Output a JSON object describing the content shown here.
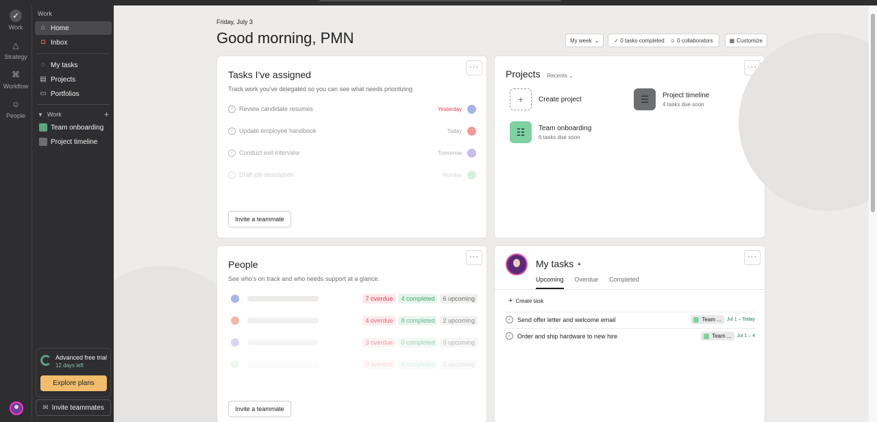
{
  "rail": {
    "items": [
      {
        "label": "Work",
        "icon": "check-circle-icon"
      },
      {
        "label": "Strategy",
        "icon": "triangle-icon"
      },
      {
        "label": "Workflow",
        "icon": "workflow-icon"
      },
      {
        "label": "People",
        "icon": "people-icon"
      }
    ]
  },
  "sidebar": {
    "header": "Work",
    "nav": [
      {
        "label": "Home",
        "icon": "home-icon"
      },
      {
        "label": "Inbox",
        "icon": "bell-icon"
      }
    ],
    "items": [
      {
        "label": "My tasks",
        "icon": "check-circle-icon"
      },
      {
        "label": "Projects",
        "icon": "clipboard-icon"
      },
      {
        "label": "Portfolios",
        "icon": "folder-icon"
      }
    ],
    "section_label": "Work",
    "projects": [
      {
        "label": "Team onboarding",
        "color": "#5da283"
      },
      {
        "label": "Project timeline",
        "color": "#6d6e6f"
      }
    ],
    "trial": {
      "title": "Advanced free trial",
      "days": "12 days left",
      "cta": "Explore plans"
    },
    "invite": "Invite teammates"
  },
  "header": {
    "date": "Friday, July 3",
    "greeting": "Good morning, PMN",
    "week": "My week",
    "tasks_completed": "0 tasks completed",
    "collaborators": "0 collaborators",
    "customize": "Customize"
  },
  "assigned": {
    "title": "Tasks I've assigned",
    "subtitle": "Track work you've delegated so you can see what needs prioritizing",
    "tasks": [
      {
        "name": "Review candidate resumes",
        "due": "Yesterday",
        "due_color": "#e8384f",
        "avatar_color": "#a6b4e8",
        "opacity": 1
      },
      {
        "name": "Update employee handbook",
        "due": "Today",
        "due_color": "#9a9a9a",
        "avatar_color": "#f08f8f",
        "opacity": 0.9
      },
      {
        "name": "Conduct exit interview",
        "due": "Tomorrow",
        "due_color": "#9a9a9a",
        "avatar_color": "#b6a8e8",
        "opacity": 0.75
      },
      {
        "name": "Draft job description",
        "due": "Monday",
        "due_color": "#9a9a9a",
        "avatar_color": "#9fd9b2",
        "opacity": 0.4
      }
    ],
    "invite": "Invite a teammate"
  },
  "projects": {
    "title": "Projects",
    "filter": "Recents",
    "create": "Create project",
    "list": [
      {
        "name": "Project timeline",
        "meta": "4 tasks due soon",
        "color": "#6d6e6f"
      },
      {
        "name": "Team onboarding",
        "meta": "6 tasks due soon",
        "color": "#7fd1a2"
      }
    ]
  },
  "people": {
    "title": "People",
    "subtitle": "See who's on track and who needs support at a glance.",
    "rows": [
      {
        "overdue": "7 overdue",
        "completed": "4 completed",
        "upcoming": "6 upcoming",
        "avatar_color": "#a6b4e8",
        "opacity": 1
      },
      {
        "overdue": "4 overdue",
        "completed": "8 completed",
        "upcoming": "2 upcoming",
        "avatar_color": "#f0a58f",
        "opacity": 0.8
      },
      {
        "overdue": "3 overdue",
        "completed": "0 completed",
        "upcoming": "0 upcoming",
        "avatar_color": "#b6a8e8",
        "opacity": 0.5
      },
      {
        "overdue": "0 overdue",
        "completed": "0 completed",
        "upcoming": "1 upcoming",
        "avatar_color": "#9fd9b2",
        "opacity": 0.2
      }
    ],
    "invite": "Invite a teammate"
  },
  "mytasks": {
    "title": "My tasks",
    "tabs": [
      "Upcoming",
      "Overdue",
      "Completed"
    ],
    "create": "Create task",
    "tasks": [
      {
        "name": "Send offer letter and welcome email",
        "tag": "Team ...",
        "date": "Jul 1 – Today"
      },
      {
        "name": "Order and ship hardware to new hire",
        "tag": "Team ...",
        "date": "Jul 1 – 4"
      }
    ]
  }
}
